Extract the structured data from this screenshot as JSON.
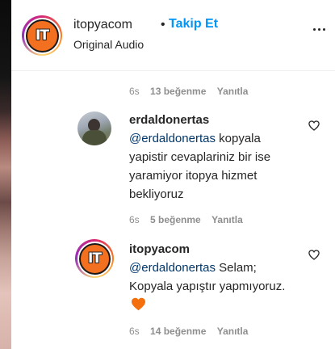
{
  "header": {
    "username": "itopyacom",
    "separator": "•",
    "follow_label": "Takip Et",
    "subtitle": "Original Audio",
    "avatar_text": "IT"
  },
  "first_meta": {
    "time": "6s",
    "likes": "13 beğenme",
    "reply": "Yanıtla"
  },
  "comments": [
    {
      "username": "erdaldonertas",
      "mention": "@erdaldonertas",
      "text_line1": " kopyala",
      "text_rest": "yapistir cevaplariniz bir ise yaramiyor itopya hizmet bekliyoruz",
      "time": "6s",
      "likes": "5 beğenme",
      "reply": "Yanıtla"
    },
    {
      "username": "itopyacom",
      "avatar_text": "IT",
      "mention": "@erdaldonertas",
      "text_line1": " Selam;",
      "text_rest": "Kopyala yapıştır yapmıyoruz. ",
      "time": "6s",
      "likes": "14 beğenme",
      "reply": "Yanıtla"
    }
  ],
  "colors": {
    "follow": "#0095f6",
    "mention": "#00376b",
    "heart_emoji": "#f4700e",
    "meta": "#8e8e8e"
  }
}
